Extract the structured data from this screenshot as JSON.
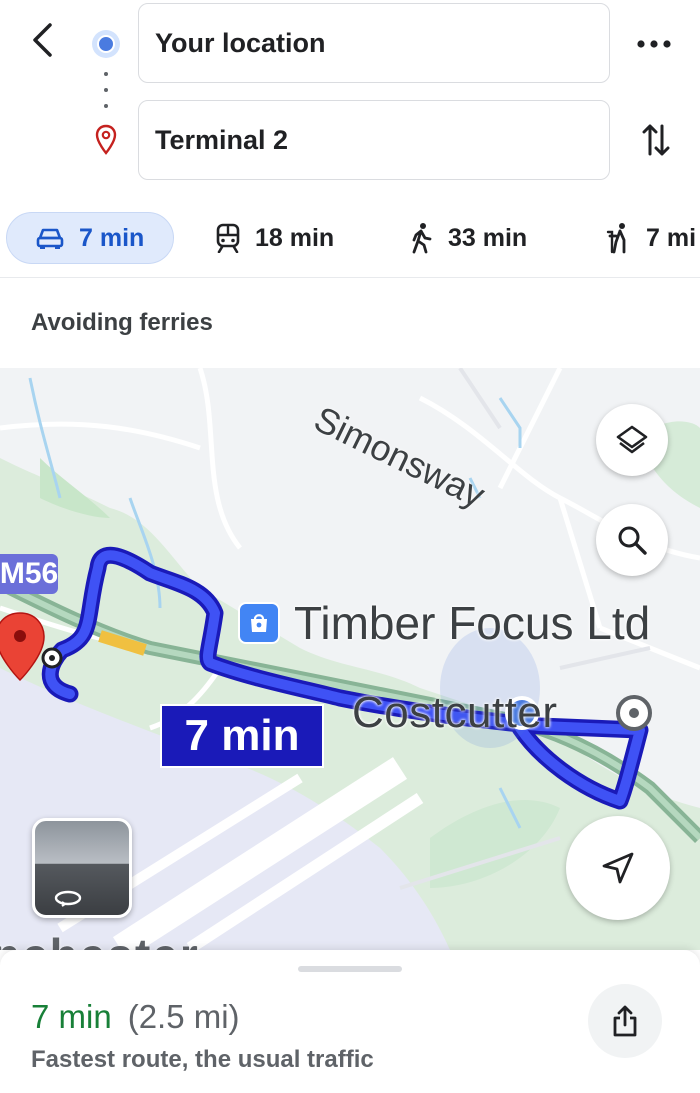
{
  "header": {
    "origin_value": "Your location",
    "destination_value": "Terminal 2"
  },
  "modes": [
    {
      "label": "7 min",
      "icon": "car-icon",
      "active": true
    },
    {
      "label": "18 min",
      "icon": "train-icon",
      "active": false
    },
    {
      "label": "33 min",
      "icon": "walk-icon",
      "active": false
    },
    {
      "label": "7 mi",
      "icon": "ride-hail-icon",
      "active": false
    }
  ],
  "route_options": {
    "text": "Avoiding ferries"
  },
  "map": {
    "road_label": "Simonsway",
    "motorway_label": "M56",
    "poi_name": "Timber Focus Ltd",
    "poi_icon": "shopping-bag-icon",
    "store_label": "Costcutter",
    "route_eta": "7 min",
    "place_label_partial": "nchester",
    "route_color": "#1a1ab8",
    "accent_color": "#4285f4"
  },
  "sheet": {
    "eta": "7 min",
    "distance": "(2.5 mi)",
    "description": "Fastest route, the usual traffic"
  }
}
